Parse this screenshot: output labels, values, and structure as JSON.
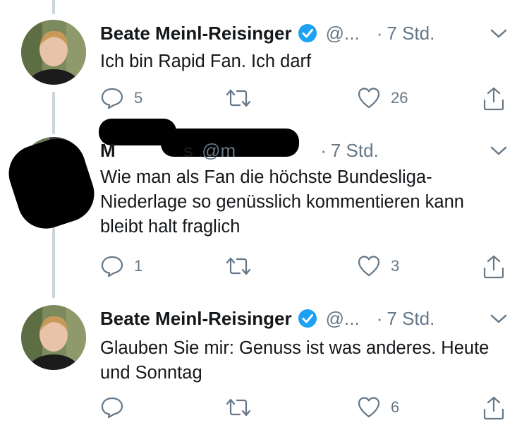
{
  "thread": [
    {
      "author": "Beate Meinl-Reisinger",
      "handle": "@...",
      "separator": "·",
      "time": "7 Std.",
      "verified": true,
      "text": "Ich bin Rapid Fan. Ich darf",
      "replies": "5",
      "retweets": "",
      "likes": "26"
    },
    {
      "author": "M",
      "author_tail": "s",
      "handle": "@m",
      "separator": "·",
      "time": "7 Std.",
      "verified": false,
      "text": "Wie man als Fan die höchste Bundesliga-Niederlage so genüsslich kommentieren kann bleibt halt fraglich",
      "replies": "1",
      "retweets": "",
      "likes": "3"
    },
    {
      "author": "Beate Meinl-Reisinger",
      "handle": "@...",
      "separator": "·",
      "time": "7 Std.",
      "verified": true,
      "text": "Glauben Sie mir: Genuss ist was anderes. Heute und Sonntag",
      "replies": "",
      "retweets": "",
      "likes": "6"
    }
  ],
  "colors": {
    "text": "#14171a",
    "secondary": "#657786",
    "verified": "#1da1f2",
    "thread_line": "#ccd6dd"
  },
  "icons": [
    "reply-icon",
    "retweet-icon",
    "like-icon",
    "share-icon",
    "verified-badge-icon",
    "chevron-down-icon"
  ]
}
